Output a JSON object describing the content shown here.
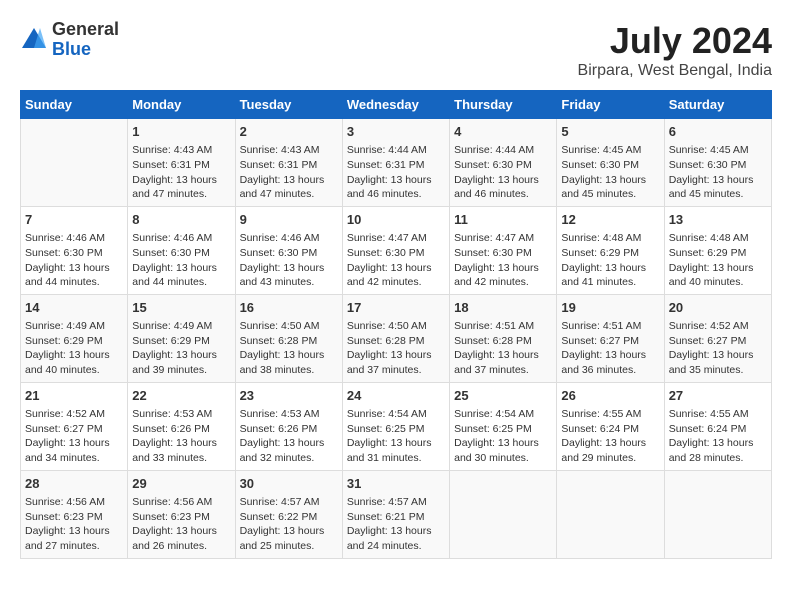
{
  "header": {
    "logo_line1": "General",
    "logo_line2": "Blue",
    "title": "July 2024",
    "subtitle": "Birpara, West Bengal, India"
  },
  "days_of_week": [
    "Sunday",
    "Monday",
    "Tuesday",
    "Wednesday",
    "Thursday",
    "Friday",
    "Saturday"
  ],
  "weeks": [
    [
      {
        "day": "",
        "info": ""
      },
      {
        "day": "1",
        "info": "Sunrise: 4:43 AM\nSunset: 6:31 PM\nDaylight: 13 hours\nand 47 minutes."
      },
      {
        "day": "2",
        "info": "Sunrise: 4:43 AM\nSunset: 6:31 PM\nDaylight: 13 hours\nand 47 minutes."
      },
      {
        "day": "3",
        "info": "Sunrise: 4:44 AM\nSunset: 6:31 PM\nDaylight: 13 hours\nand 46 minutes."
      },
      {
        "day": "4",
        "info": "Sunrise: 4:44 AM\nSunset: 6:30 PM\nDaylight: 13 hours\nand 46 minutes."
      },
      {
        "day": "5",
        "info": "Sunrise: 4:45 AM\nSunset: 6:30 PM\nDaylight: 13 hours\nand 45 minutes."
      },
      {
        "day": "6",
        "info": "Sunrise: 4:45 AM\nSunset: 6:30 PM\nDaylight: 13 hours\nand 45 minutes."
      }
    ],
    [
      {
        "day": "7",
        "info": "Sunrise: 4:46 AM\nSunset: 6:30 PM\nDaylight: 13 hours\nand 44 minutes."
      },
      {
        "day": "8",
        "info": "Sunrise: 4:46 AM\nSunset: 6:30 PM\nDaylight: 13 hours\nand 44 minutes."
      },
      {
        "day": "9",
        "info": "Sunrise: 4:46 AM\nSunset: 6:30 PM\nDaylight: 13 hours\nand 43 minutes."
      },
      {
        "day": "10",
        "info": "Sunrise: 4:47 AM\nSunset: 6:30 PM\nDaylight: 13 hours\nand 42 minutes."
      },
      {
        "day": "11",
        "info": "Sunrise: 4:47 AM\nSunset: 6:30 PM\nDaylight: 13 hours\nand 42 minutes."
      },
      {
        "day": "12",
        "info": "Sunrise: 4:48 AM\nSunset: 6:29 PM\nDaylight: 13 hours\nand 41 minutes."
      },
      {
        "day": "13",
        "info": "Sunrise: 4:48 AM\nSunset: 6:29 PM\nDaylight: 13 hours\nand 40 minutes."
      }
    ],
    [
      {
        "day": "14",
        "info": "Sunrise: 4:49 AM\nSunset: 6:29 PM\nDaylight: 13 hours\nand 40 minutes."
      },
      {
        "day": "15",
        "info": "Sunrise: 4:49 AM\nSunset: 6:29 PM\nDaylight: 13 hours\nand 39 minutes."
      },
      {
        "day": "16",
        "info": "Sunrise: 4:50 AM\nSunset: 6:28 PM\nDaylight: 13 hours\nand 38 minutes."
      },
      {
        "day": "17",
        "info": "Sunrise: 4:50 AM\nSunset: 6:28 PM\nDaylight: 13 hours\nand 37 minutes."
      },
      {
        "day": "18",
        "info": "Sunrise: 4:51 AM\nSunset: 6:28 PM\nDaylight: 13 hours\nand 37 minutes."
      },
      {
        "day": "19",
        "info": "Sunrise: 4:51 AM\nSunset: 6:27 PM\nDaylight: 13 hours\nand 36 minutes."
      },
      {
        "day": "20",
        "info": "Sunrise: 4:52 AM\nSunset: 6:27 PM\nDaylight: 13 hours\nand 35 minutes."
      }
    ],
    [
      {
        "day": "21",
        "info": "Sunrise: 4:52 AM\nSunset: 6:27 PM\nDaylight: 13 hours\nand 34 minutes."
      },
      {
        "day": "22",
        "info": "Sunrise: 4:53 AM\nSunset: 6:26 PM\nDaylight: 13 hours\nand 33 minutes."
      },
      {
        "day": "23",
        "info": "Sunrise: 4:53 AM\nSunset: 6:26 PM\nDaylight: 13 hours\nand 32 minutes."
      },
      {
        "day": "24",
        "info": "Sunrise: 4:54 AM\nSunset: 6:25 PM\nDaylight: 13 hours\nand 31 minutes."
      },
      {
        "day": "25",
        "info": "Sunrise: 4:54 AM\nSunset: 6:25 PM\nDaylight: 13 hours\nand 30 minutes."
      },
      {
        "day": "26",
        "info": "Sunrise: 4:55 AM\nSunset: 6:24 PM\nDaylight: 13 hours\nand 29 minutes."
      },
      {
        "day": "27",
        "info": "Sunrise: 4:55 AM\nSunset: 6:24 PM\nDaylight: 13 hours\nand 28 minutes."
      }
    ],
    [
      {
        "day": "28",
        "info": "Sunrise: 4:56 AM\nSunset: 6:23 PM\nDaylight: 13 hours\nand 27 minutes."
      },
      {
        "day": "29",
        "info": "Sunrise: 4:56 AM\nSunset: 6:23 PM\nDaylight: 13 hours\nand 26 minutes."
      },
      {
        "day": "30",
        "info": "Sunrise: 4:57 AM\nSunset: 6:22 PM\nDaylight: 13 hours\nand 25 minutes."
      },
      {
        "day": "31",
        "info": "Sunrise: 4:57 AM\nSunset: 6:21 PM\nDaylight: 13 hours\nand 24 minutes."
      },
      {
        "day": "",
        "info": ""
      },
      {
        "day": "",
        "info": ""
      },
      {
        "day": "",
        "info": ""
      }
    ]
  ]
}
